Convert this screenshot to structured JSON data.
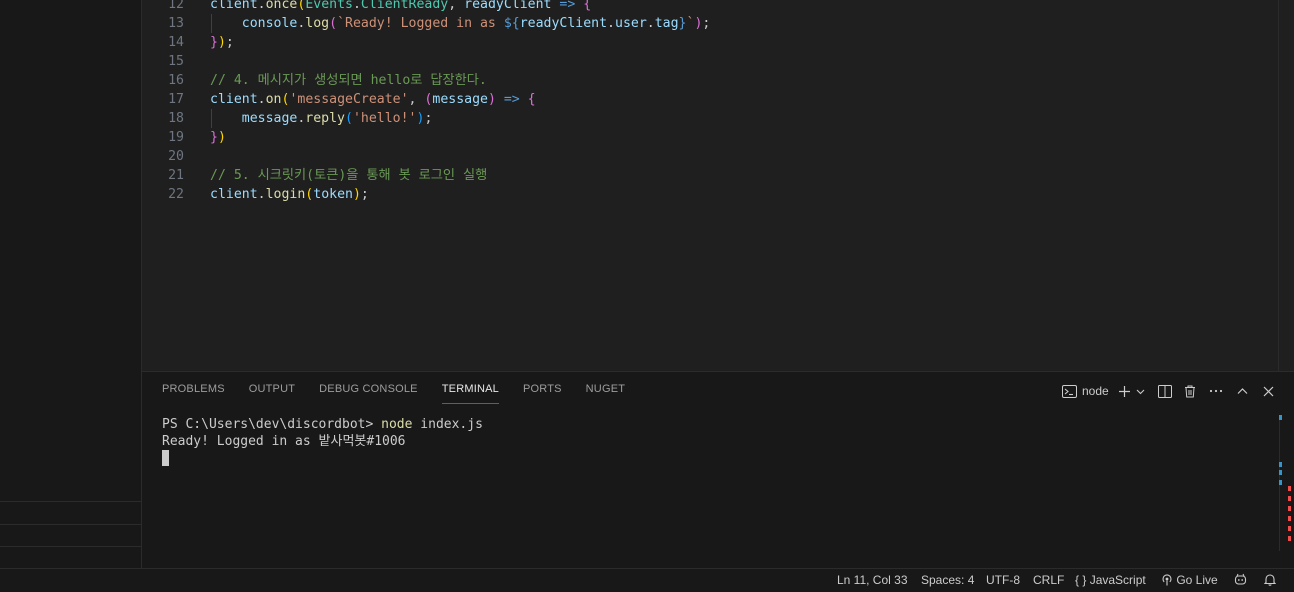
{
  "editor": {
    "lines": [
      {
        "num": "12",
        "tokens": [
          {
            "t": "client",
            "c": "t-var"
          },
          {
            "t": ".",
            "c": "t-punc"
          },
          {
            "t": "once",
            "c": "t-fn"
          },
          {
            "t": "(",
            "c": "t-br1"
          },
          {
            "t": "Events",
            "c": "t-cls"
          },
          {
            "t": ".",
            "c": "t-punc"
          },
          {
            "t": "ClientReady",
            "c": "t-cls"
          },
          {
            "t": ", ",
            "c": "t-punc"
          },
          {
            "t": "readyClient",
            "c": "t-var"
          },
          {
            "t": " => ",
            "c": "t-kw"
          },
          {
            "t": "{",
            "c": "t-br2"
          }
        ]
      },
      {
        "num": "13",
        "tokens": [
          {
            "t": "    console",
            "c": "t-var"
          },
          {
            "t": ".",
            "c": "t-punc"
          },
          {
            "t": "log",
            "c": "t-fn"
          },
          {
            "t": "(",
            "c": "t-br2"
          },
          {
            "t": "`Ready! Logged in as ",
            "c": "t-str"
          },
          {
            "t": "${",
            "c": "t-kw"
          },
          {
            "t": "readyClient",
            "c": "t-var"
          },
          {
            "t": ".",
            "c": "t-punc"
          },
          {
            "t": "user",
            "c": "t-var"
          },
          {
            "t": ".",
            "c": "t-punc"
          },
          {
            "t": "tag",
            "c": "t-var"
          },
          {
            "t": "}",
            "c": "t-kw"
          },
          {
            "t": "`",
            "c": "t-str"
          },
          {
            "t": ")",
            "c": "t-br2"
          },
          {
            "t": ";",
            "c": "t-punc"
          }
        ]
      },
      {
        "num": "14",
        "tokens": [
          {
            "t": "}",
            "c": "t-br2"
          },
          {
            "t": ")",
            "c": "t-br1"
          },
          {
            "t": ";",
            "c": "t-punc"
          }
        ]
      },
      {
        "num": "15",
        "tokens": []
      },
      {
        "num": "16",
        "tokens": [
          {
            "t": "// 4. 메시지가 생성되면 hello로 답장한다.",
            "c": "t-com"
          }
        ]
      },
      {
        "num": "17",
        "tokens": [
          {
            "t": "client",
            "c": "t-var"
          },
          {
            "t": ".",
            "c": "t-punc"
          },
          {
            "t": "on",
            "c": "t-fn"
          },
          {
            "t": "(",
            "c": "t-br1"
          },
          {
            "t": "'messageCreate'",
            "c": "t-str"
          },
          {
            "t": ", ",
            "c": "t-punc"
          },
          {
            "t": "(",
            "c": "t-br2"
          },
          {
            "t": "message",
            "c": "t-var"
          },
          {
            "t": ")",
            "c": "t-br2"
          },
          {
            "t": " => ",
            "c": "t-kw"
          },
          {
            "t": "{",
            "c": "t-br2"
          }
        ]
      },
      {
        "num": "18",
        "tokens": [
          {
            "t": "    message",
            "c": "t-var"
          },
          {
            "t": ".",
            "c": "t-punc"
          },
          {
            "t": "reply",
            "c": "t-fn"
          },
          {
            "t": "(",
            "c": "t-br3"
          },
          {
            "t": "'hello!'",
            "c": "t-str"
          },
          {
            "t": ")",
            "c": "t-br3"
          },
          {
            "t": ";",
            "c": "t-punc"
          }
        ]
      },
      {
        "num": "19",
        "tokens": [
          {
            "t": "}",
            "c": "t-br2"
          },
          {
            "t": ")",
            "c": "t-br1"
          }
        ]
      },
      {
        "num": "20",
        "tokens": []
      },
      {
        "num": "21",
        "tokens": [
          {
            "t": "// 5. 시크릿키(토큰)을 통해 봇 로그인 실행",
            "c": "t-com"
          }
        ]
      },
      {
        "num": "22",
        "tokens": [
          {
            "t": "client",
            "c": "t-var"
          },
          {
            "t": ".",
            "c": "t-punc"
          },
          {
            "t": "login",
            "c": "t-fn"
          },
          {
            "t": "(",
            "c": "t-br1"
          },
          {
            "t": "token",
            "c": "t-var"
          },
          {
            "t": ")",
            "c": "t-br1"
          },
          {
            "t": ";",
            "c": "t-punc"
          }
        ]
      }
    ]
  },
  "panel": {
    "tabs": [
      {
        "label": "PROBLEMS",
        "name": "tab-problems",
        "active": false
      },
      {
        "label": "OUTPUT",
        "name": "tab-output",
        "active": false
      },
      {
        "label": "DEBUG CONSOLE",
        "name": "tab-debug-console",
        "active": false
      },
      {
        "label": "TERMINAL",
        "name": "tab-terminal",
        "active": true
      },
      {
        "label": "PORTS",
        "name": "tab-ports",
        "active": false
      },
      {
        "label": "NUGET",
        "name": "tab-nuget",
        "active": false
      }
    ],
    "terminal_name": "node",
    "icons": {
      "terminal": "terminal-icon",
      "add": "plus-icon",
      "dropdown": "chevron-down-icon",
      "split": "split-terminal-icon",
      "kill": "trash-icon",
      "more": "more-actions-icon",
      "maximize": "chevron-up-icon",
      "close": "close-icon"
    }
  },
  "terminal": {
    "prompt": "PS C:\\Users\\dev\\discordbot> ",
    "command": "node",
    "args": " index.js",
    "output": "Ready! Logged in as 밭사먹봇#1006"
  },
  "statusbar": {
    "position": "Ln 11, Col 33",
    "spaces": "Spaces: 4",
    "encoding": "UTF-8",
    "eol": "CRLF",
    "language_icon": "{ }",
    "language": "JavaScript",
    "golive": "Go Live",
    "icons": {
      "broadcast": "broadcast-icon",
      "copilot": "copilot-icon",
      "bell": "bell-icon"
    }
  },
  "colors": {
    "accent": "#0078d4",
    "command": "#dcdcaa",
    "scroll_blue": "#3794c9",
    "scroll_red": "#f14c4c"
  }
}
